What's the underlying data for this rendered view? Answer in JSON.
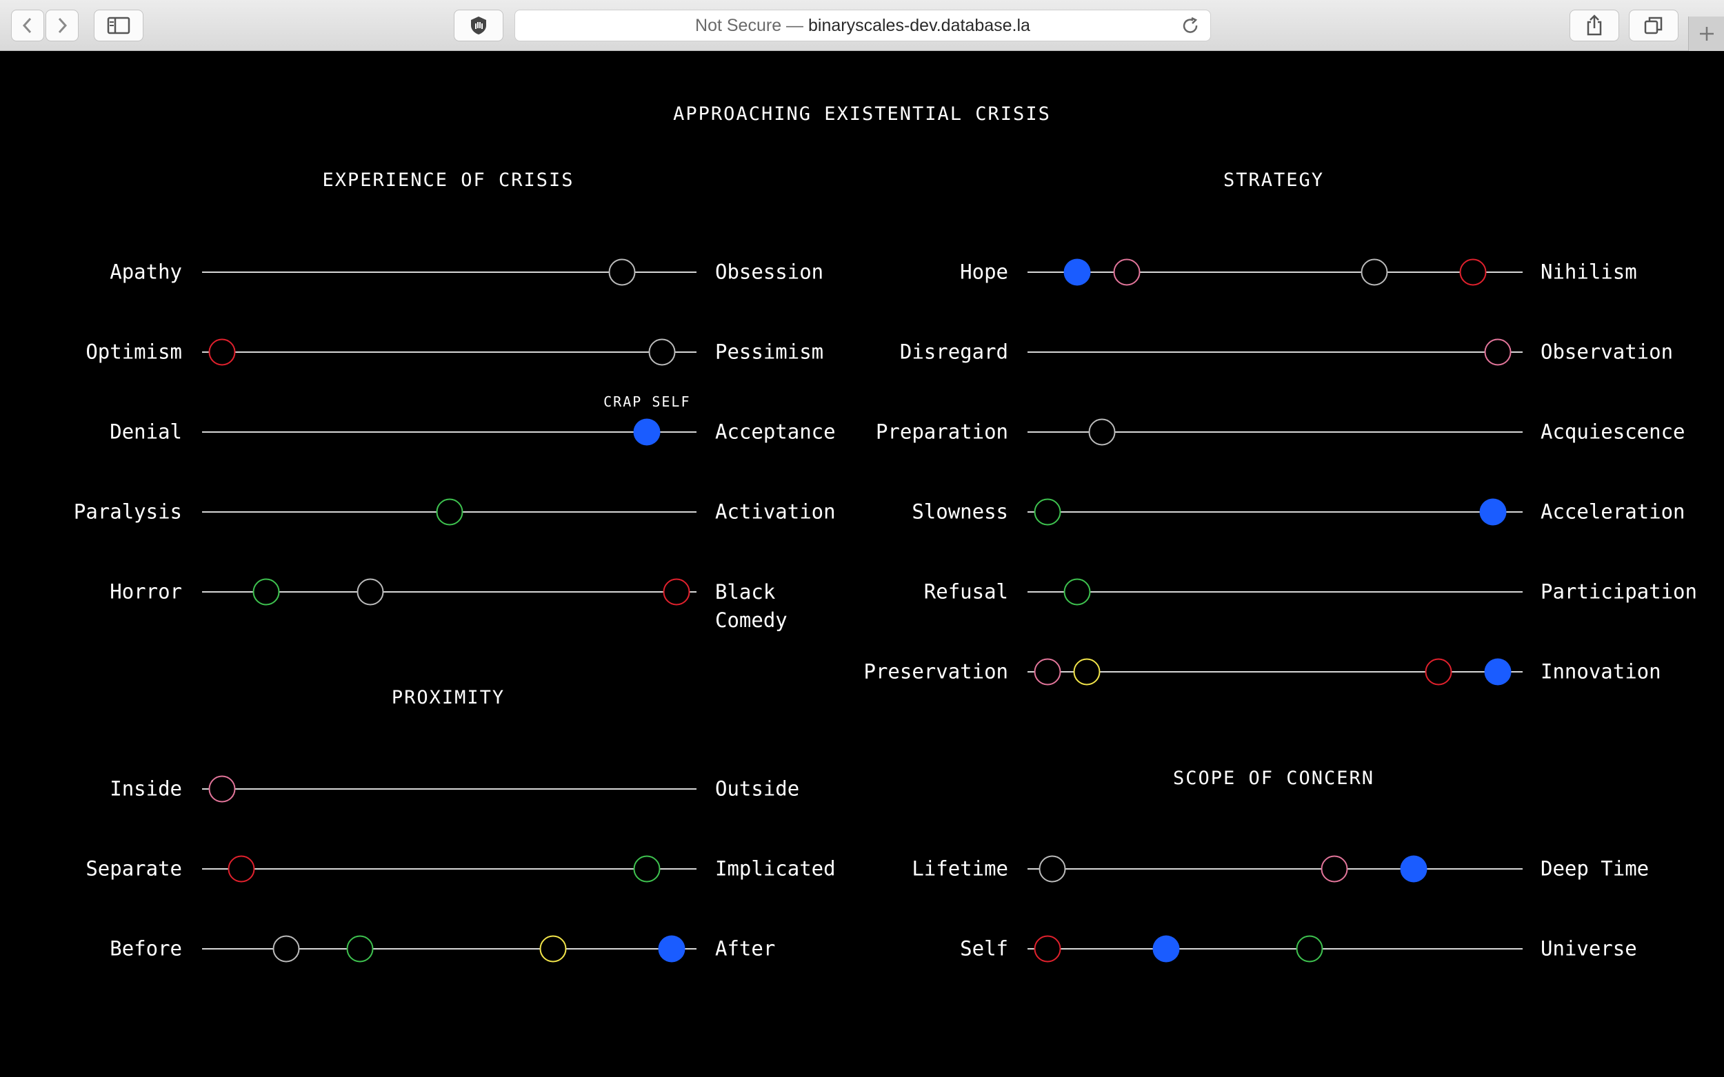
{
  "browser": {
    "url_prefix": "Not Secure —",
    "url_host": "binaryscales-dev.database.la"
  },
  "colors": {
    "white": "#bbbbbb",
    "red": "#e0212d",
    "pink": "#e2759a",
    "green": "#3ec24f",
    "yellow": "#f2e54a",
    "blue": "#1a5cff"
  },
  "page_title": "APPROACHING EXISTENTIAL CRISIS",
  "sections": [
    {
      "id": "experience",
      "title": "EXPERIENCE OF CRISIS",
      "scales": [
        {
          "left": "Apathy",
          "right": "Obsession",
          "markers": [
            {
              "value": 0.85,
              "color": "white"
            }
          ]
        },
        {
          "left": "Optimism",
          "right": "Pessimism",
          "markers": [
            {
              "value": 0.04,
              "color": "red"
            },
            {
              "value": 0.93,
              "color": "white"
            }
          ]
        },
        {
          "left": "Denial",
          "right": "Acceptance",
          "markers": [
            {
              "value": 0.9,
              "color": "blue",
              "filled": true,
              "label": "CRAP SELF"
            }
          ]
        },
        {
          "left": "Paralysis",
          "right": "Activation",
          "markers": [
            {
              "value": 0.5,
              "color": "green"
            }
          ]
        },
        {
          "left": "Horror",
          "right": "Black Comedy",
          "markers": [
            {
              "value": 0.13,
              "color": "green"
            },
            {
              "value": 0.34,
              "color": "white"
            },
            {
              "value": 0.96,
              "color": "red"
            }
          ]
        }
      ]
    },
    {
      "id": "proximity",
      "title": "PROXIMITY",
      "scales": [
        {
          "left": "Inside",
          "right": "Outside",
          "markers": [
            {
              "value": 0.04,
              "color": "pink"
            }
          ]
        },
        {
          "left": "Separate",
          "right": "Implicated",
          "markers": [
            {
              "value": 0.08,
              "color": "red"
            },
            {
              "value": 0.9,
              "color": "green"
            }
          ]
        },
        {
          "left": "Before",
          "right": "After",
          "markers": [
            {
              "value": 0.17,
              "color": "white"
            },
            {
              "value": 0.32,
              "color": "green"
            },
            {
              "value": 0.71,
              "color": "yellow"
            },
            {
              "value": 0.95,
              "color": "blue",
              "filled": true
            }
          ]
        }
      ]
    },
    {
      "id": "strategy",
      "title": "STRATEGY",
      "scales": [
        {
          "left": "Hope",
          "right": "Nihilism",
          "markers": [
            {
              "value": 0.1,
              "color": "blue",
              "filled": true
            },
            {
              "value": 0.2,
              "color": "pink"
            },
            {
              "value": 0.7,
              "color": "white"
            },
            {
              "value": 0.9,
              "color": "red"
            }
          ]
        },
        {
          "left": "Disregard",
          "right": "Observation",
          "markers": [
            {
              "value": 0.95,
              "color": "pink"
            }
          ]
        },
        {
          "left": "Preparation",
          "right": "Acquiescence",
          "markers": [
            {
              "value": 0.15,
              "color": "white"
            }
          ]
        },
        {
          "left": "Slowness",
          "right": "Acceleration",
          "markers": [
            {
              "value": 0.04,
              "color": "green"
            },
            {
              "value": 0.94,
              "color": "blue",
              "filled": true
            }
          ]
        },
        {
          "left": "Refusal",
          "right": "Participation",
          "markers": [
            {
              "value": 0.1,
              "color": "green"
            }
          ]
        },
        {
          "left": "Preservation",
          "right": "Innovation",
          "markers": [
            {
              "value": 0.04,
              "color": "pink"
            },
            {
              "value": 0.12,
              "color": "yellow"
            },
            {
              "value": 0.83,
              "color": "red"
            },
            {
              "value": 0.95,
              "color": "blue",
              "filled": true
            }
          ]
        }
      ]
    },
    {
      "id": "scope",
      "title": "SCOPE OF CONCERN",
      "scales": [
        {
          "left": "Lifetime",
          "right": "Deep Time",
          "markers": [
            {
              "value": 0.05,
              "color": "white"
            },
            {
              "value": 0.62,
              "color": "pink"
            },
            {
              "value": 0.78,
              "color": "blue",
              "filled": true
            }
          ]
        },
        {
          "left": "Self",
          "right": "Universe",
          "markers": [
            {
              "value": 0.04,
              "color": "red"
            },
            {
              "value": 0.28,
              "color": "blue",
              "filled": true
            },
            {
              "value": 0.57,
              "color": "green"
            }
          ]
        }
      ]
    }
  ]
}
